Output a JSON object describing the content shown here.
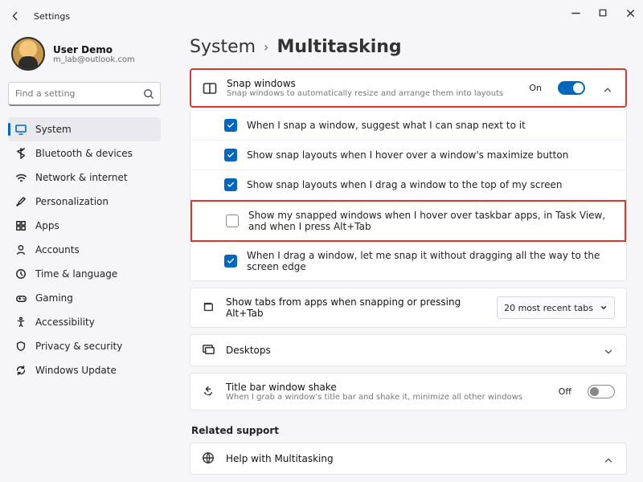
{
  "titlebar": {
    "title": "Settings"
  },
  "user": {
    "name": "User Demo",
    "email": "m_lab@outlook.com"
  },
  "search": {
    "placeholder": "Find a setting"
  },
  "nav": {
    "items": [
      {
        "label": "System"
      },
      {
        "label": "Bluetooth & devices"
      },
      {
        "label": "Network & internet"
      },
      {
        "label": "Personalization"
      },
      {
        "label": "Apps"
      },
      {
        "label": "Accounts"
      },
      {
        "label": "Time & language"
      },
      {
        "label": "Gaming"
      },
      {
        "label": "Accessibility"
      },
      {
        "label": "Privacy & security"
      },
      {
        "label": "Windows Update"
      }
    ]
  },
  "breadcrumb": {
    "parent": "System",
    "current": "Multitasking"
  },
  "snap": {
    "title": "Snap windows",
    "sub": "Snap windows to automatically resize and arrange them into layouts",
    "state": "On",
    "options": [
      "When I snap a window, suggest what I can snap next to it",
      "Show snap layouts when I hover over a window's maximize button",
      "Show snap layouts when I drag a window to the top of my screen",
      "Show my snapped windows when I hover over taskbar apps, in Task View, and when I press Alt+Tab",
      "When I drag a window, let me snap it without dragging all the way to the screen edge"
    ]
  },
  "tabs": {
    "title": "Show tabs from apps when snapping or pressing Alt+Tab",
    "selected": "20 most recent tabs"
  },
  "desktops": {
    "title": "Desktops"
  },
  "shake": {
    "title": "Title bar window shake",
    "sub": "When I grab a window's title bar and shake it, minimize all other windows",
    "state": "Off"
  },
  "related": {
    "heading": "Related support",
    "help": "Help with Multitasking"
  }
}
